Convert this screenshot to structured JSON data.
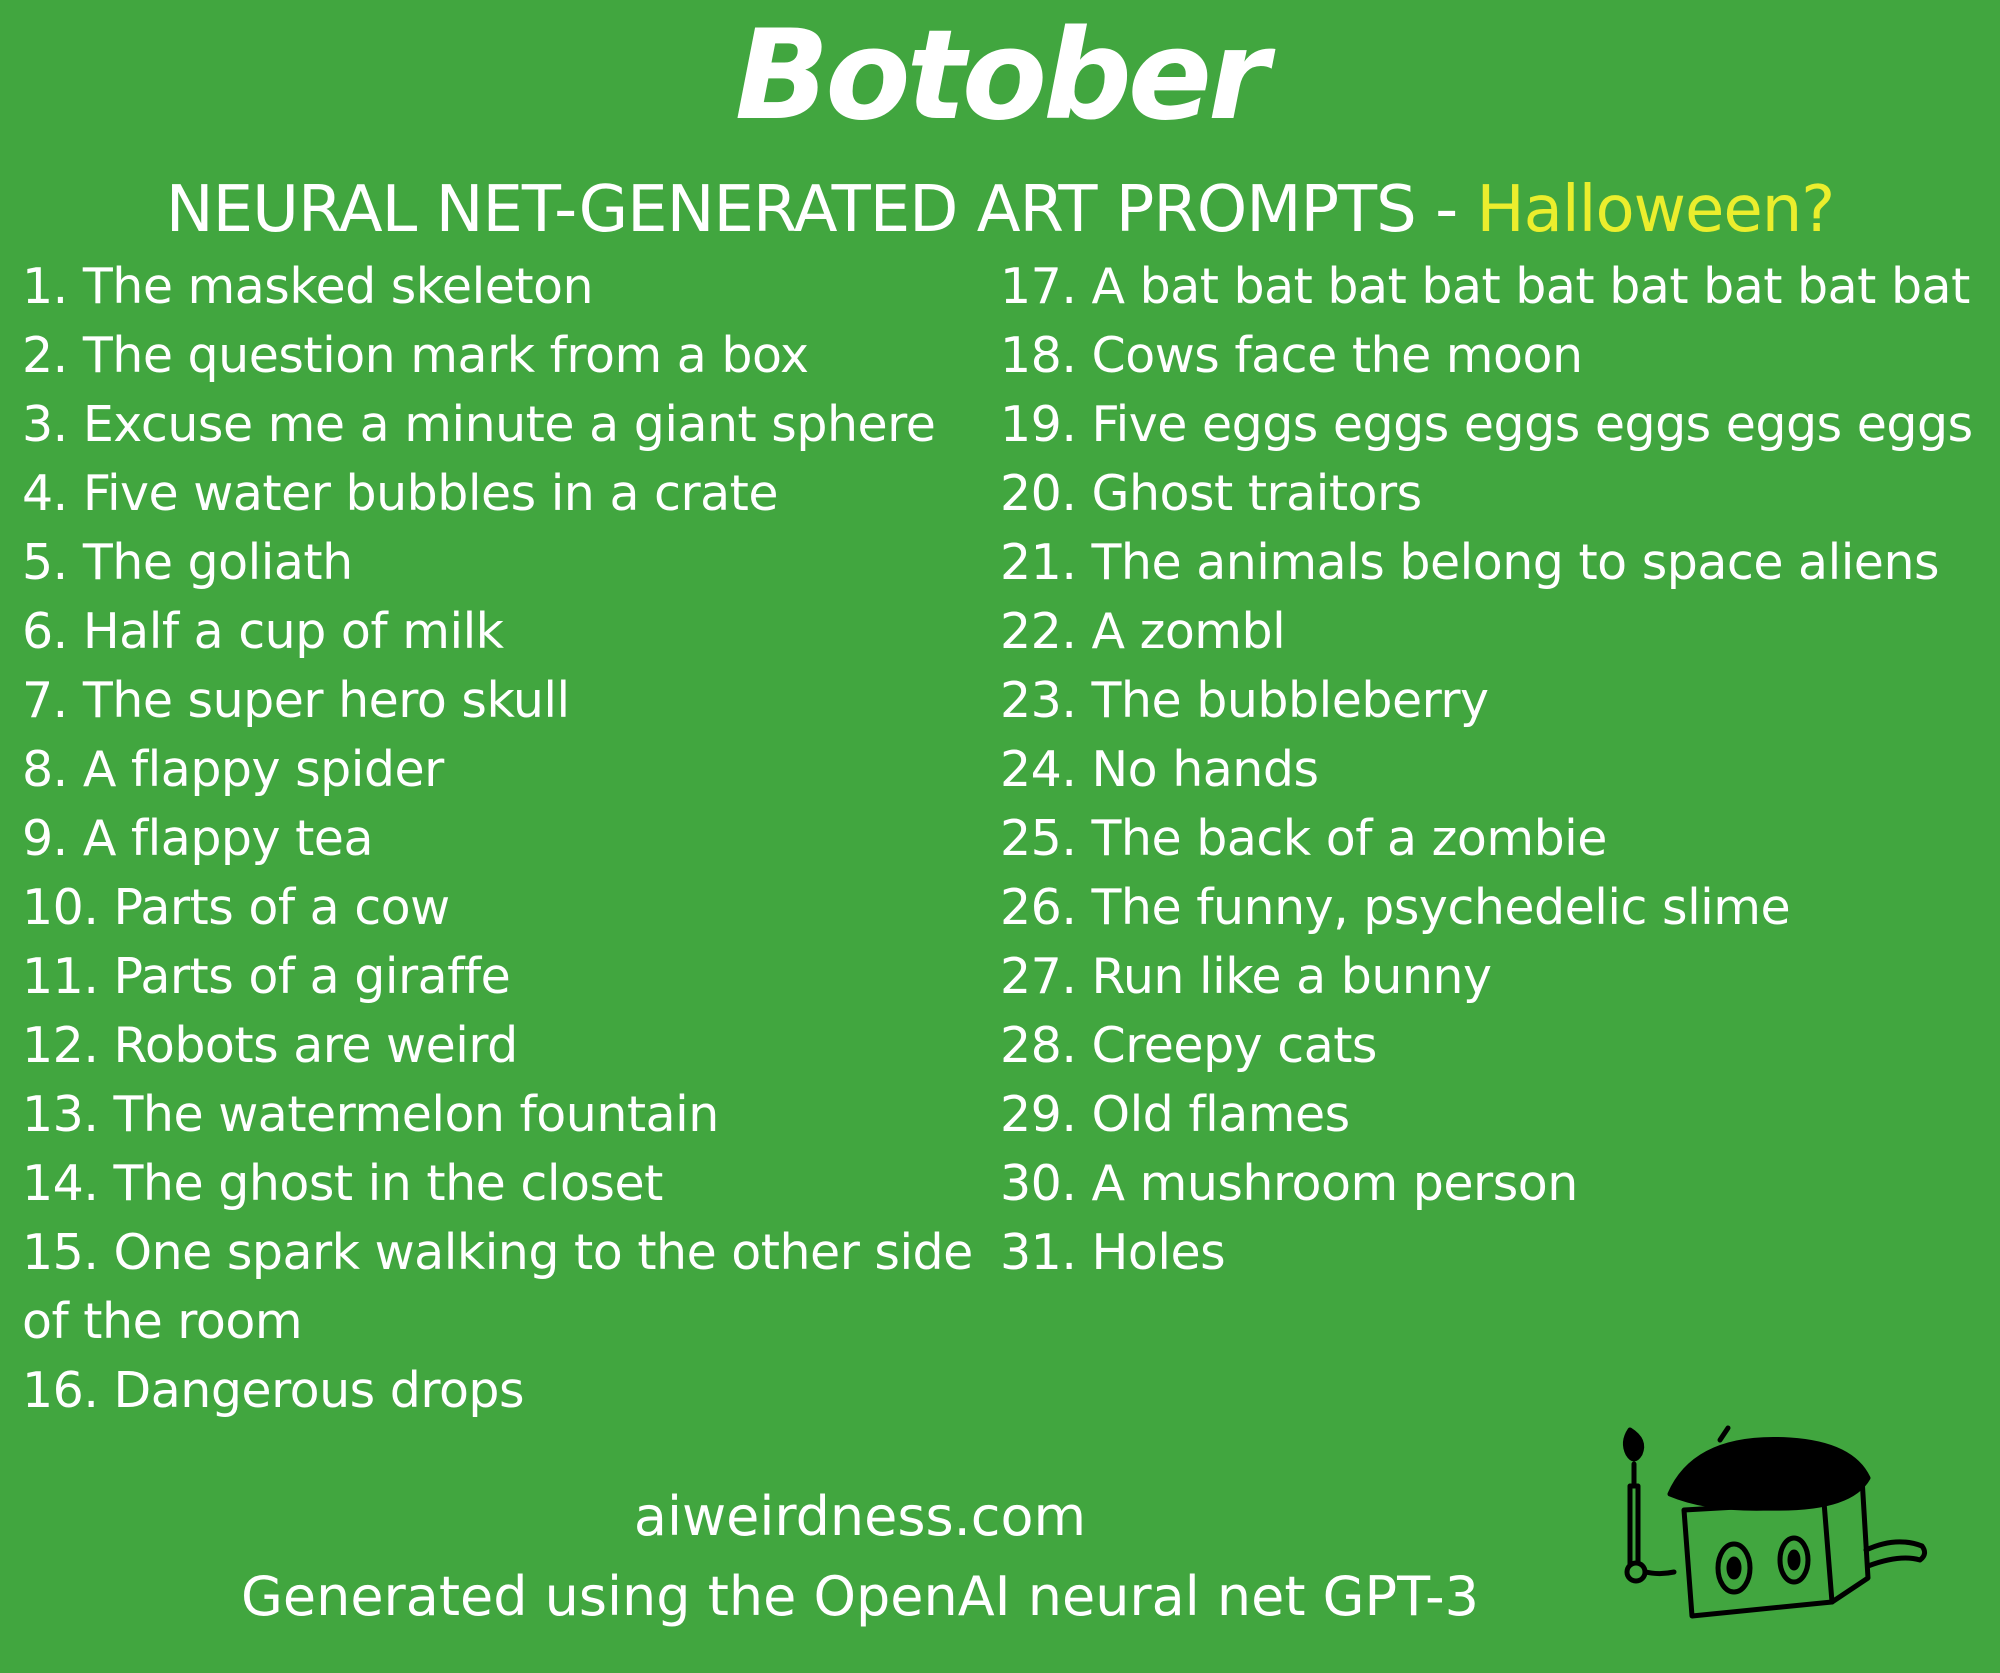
{
  "title": "Botober",
  "subtitle": {
    "main": "NEURAL NET-GENERATED ART PROMPTS - ",
    "accent": "Halloween?"
  },
  "colors": {
    "background": "#41a63f",
    "text": "#ffffff",
    "accent": "#ebee2d"
  },
  "prompts_left": [
    "1. The masked skeleton",
    "2. The question mark from a box",
    "3. Excuse me a minute a giant sphere",
    "4. Five water bubbles in a crate",
    "5. The goliath",
    "6. Half a cup of milk",
    "7. The super hero skull",
    "8. A flappy spider",
    "9. A flappy tea",
    "10. Parts of a cow",
    "11. Parts of a giraffe",
    "12. Robots are weird",
    "13. The watermelon fountain",
    "14. The ghost in the closet",
    "15. One spark walking to the other side",
    "of the room",
    "16. Dangerous drops"
  ],
  "prompts_right": [
    "17. A bat bat bat bat bat bat bat bat bat",
    "18. Cows face the moon",
    "19. Five eggs eggs eggs eggs eggs eggs",
    "20. Ghost traitors",
    "21. The animals belong to space aliens",
    "22. A zombl",
    "23. The bubbleberry",
    "24. No hands",
    "25. The back of a zombie",
    "26. The funny, psychedelic slime",
    "27. Run like a bunny",
    "28. Creepy cats",
    "29. Old flames",
    "30. A mushroom person",
    "31. Holes"
  ],
  "footer": {
    "site": "aiweirdness.com",
    "credit": "Generated using the OpenAI neural net GPT-3"
  },
  "illustration": "robot-artist-icon"
}
